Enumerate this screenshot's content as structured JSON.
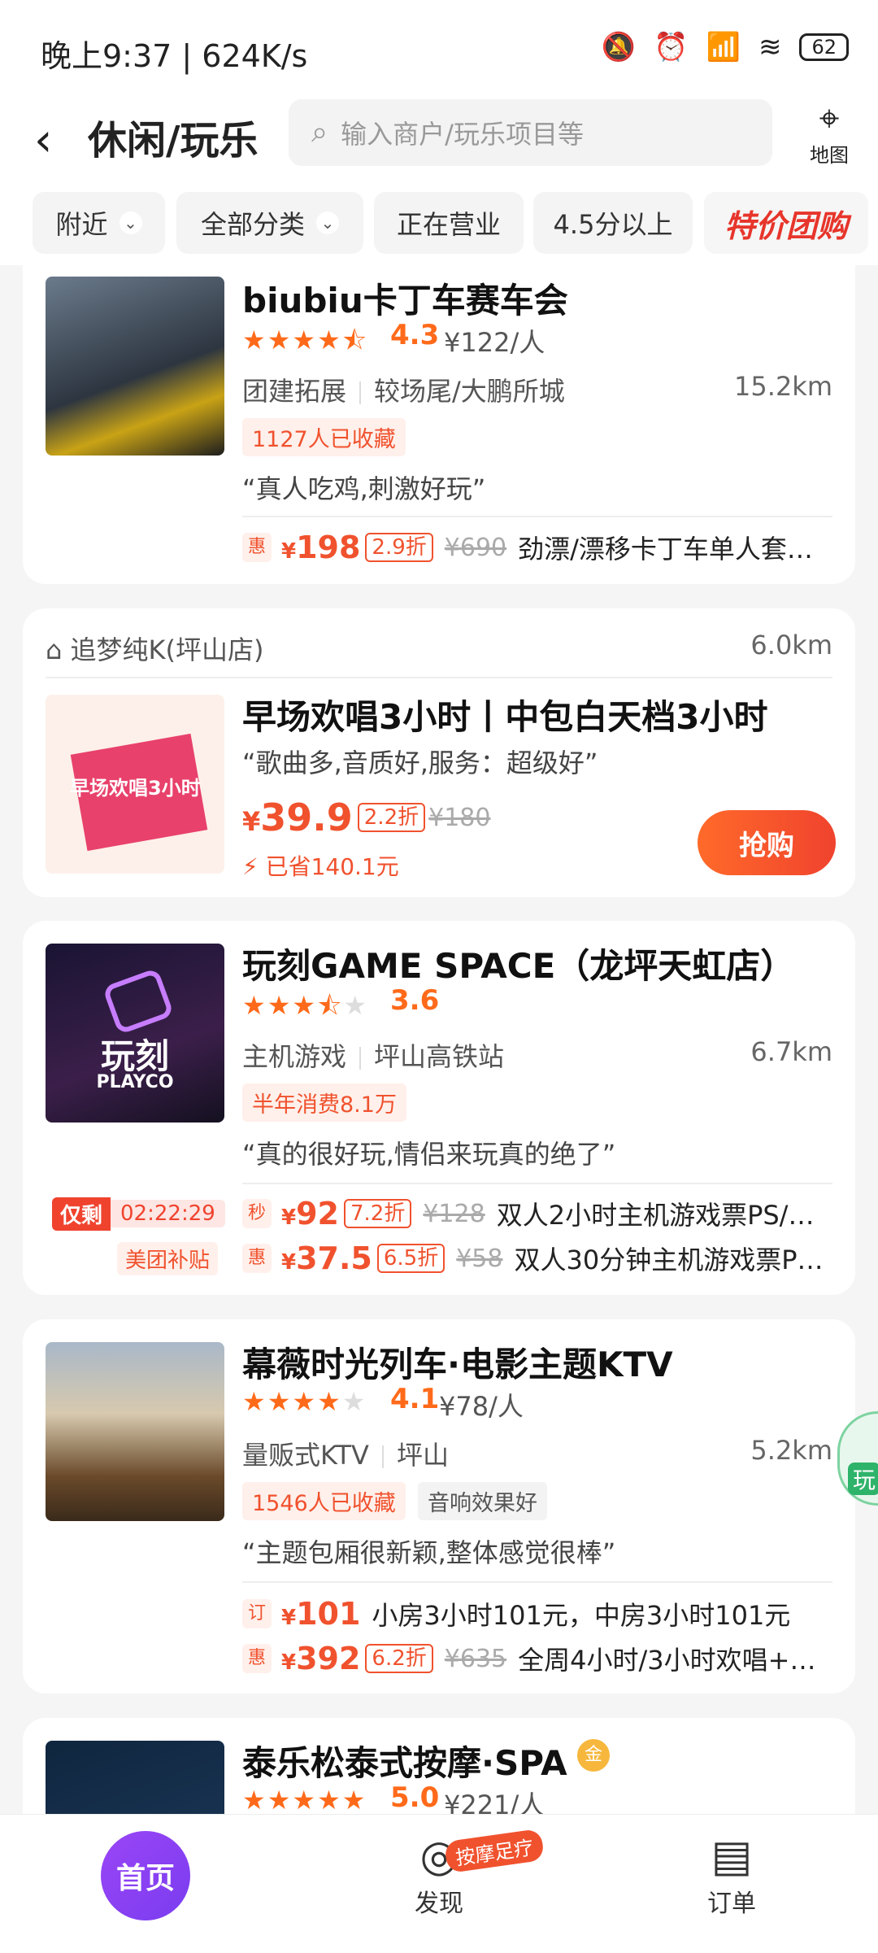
{
  "status": {
    "time": "晚上9:37 | 624K/s",
    "battery": "62"
  },
  "header": {
    "back_icon": "chevron-left-icon",
    "title": "休闲/玩乐",
    "search_placeholder": "输入商户/玩乐项目等",
    "map_label": "地图"
  },
  "filters": [
    {
      "label": "附近",
      "dropdown": true
    },
    {
      "label": "全部分类",
      "dropdown": true
    },
    {
      "label": "正在营业",
      "dropdown": false
    },
    {
      "label": "4.5分以上",
      "dropdown": false
    },
    {
      "label": "特价团购",
      "dropdown": false
    }
  ],
  "cards": {
    "c1": {
      "name": "biubiu卡丁车赛车会",
      "rating": "4.3",
      "avg_price": "¥122/人",
      "category": "团建拓展",
      "area": "较场尾/大鹏所城",
      "distance": "15.2km",
      "tag": "1127人已收藏",
      "quote": "“真人吃鸡,刺激好玩”",
      "deal": {
        "icon": "惠",
        "price": "198",
        "discount": "2.9折",
        "original": "¥690",
        "desc": "劲漂/漂移卡丁车单人套…"
      }
    },
    "c2": {
      "store": "追梦纯K(坪山店)",
      "distance": "6.0km",
      "name": "早场欢唱3小时丨中包白天档3小时",
      "quote": "“歌曲多,音质好,服务：超级好”",
      "price": "39.9",
      "discount": "2.2折",
      "original": "¥180",
      "saved": "已省140.1元",
      "buy": "抢购",
      "thumb_text": "早场欢唱3小时"
    },
    "c3": {
      "name": "玩刻GAME SPACE（龙坪天虹店）",
      "rating": "3.6",
      "category": "主机游戏",
      "area": "坪山高铁站",
      "distance": "6.7km",
      "tag": "半年消费8.1万",
      "quote": "“真的很好玩,情侣来玩真的绝了”",
      "timer_label": "仅剩",
      "timer": "02:22:29",
      "subsidy": "美团补贴",
      "thumb_text": "玩刻",
      "thumb_sub": "PLAYCO",
      "deals": [
        {
          "icon": "秒",
          "price": "92",
          "discount": "7.2折",
          "original": "¥128",
          "desc": "双人2小时主机游戏票PS/…"
        },
        {
          "icon": "惠",
          "price": "37.5",
          "discount": "6.5折",
          "original": "¥58",
          "desc": "双人30分钟主机游戏票P…"
        }
      ]
    },
    "c4": {
      "name": "幕薇时光列车·电影主题KTV",
      "rating": "4.1",
      "avg_price": "¥78/人",
      "category": "量贩式KTV",
      "area": "坪山",
      "distance": "5.2km",
      "tags": [
        "1546人已收藏",
        "音响效果好"
      ],
      "quote": "“主题包厢很新颖,整体感觉很棒”",
      "deals": [
        {
          "icon": "订",
          "price": "101",
          "desc": "小房3小时101元，中房3小时101元"
        },
        {
          "icon": "惠",
          "price": "392",
          "discount": "6.2折",
          "original": "¥635",
          "desc": "全周4小时/3小时欢唱+…"
        }
      ]
    },
    "c5": {
      "name": "泰乐松泰式按摩·SPA",
      "badge": "金",
      "rating": "5.0",
      "avg_price": "¥221/人"
    }
  },
  "float_badge": "玩",
  "bottom_nav": {
    "home": "首页",
    "discover": "发现",
    "discover_badge": "按摩足疗",
    "orders": "订单"
  },
  "colors": {
    "accent": "#f0522e",
    "star": "#ff6a1a",
    "home": "#8a40f2"
  }
}
